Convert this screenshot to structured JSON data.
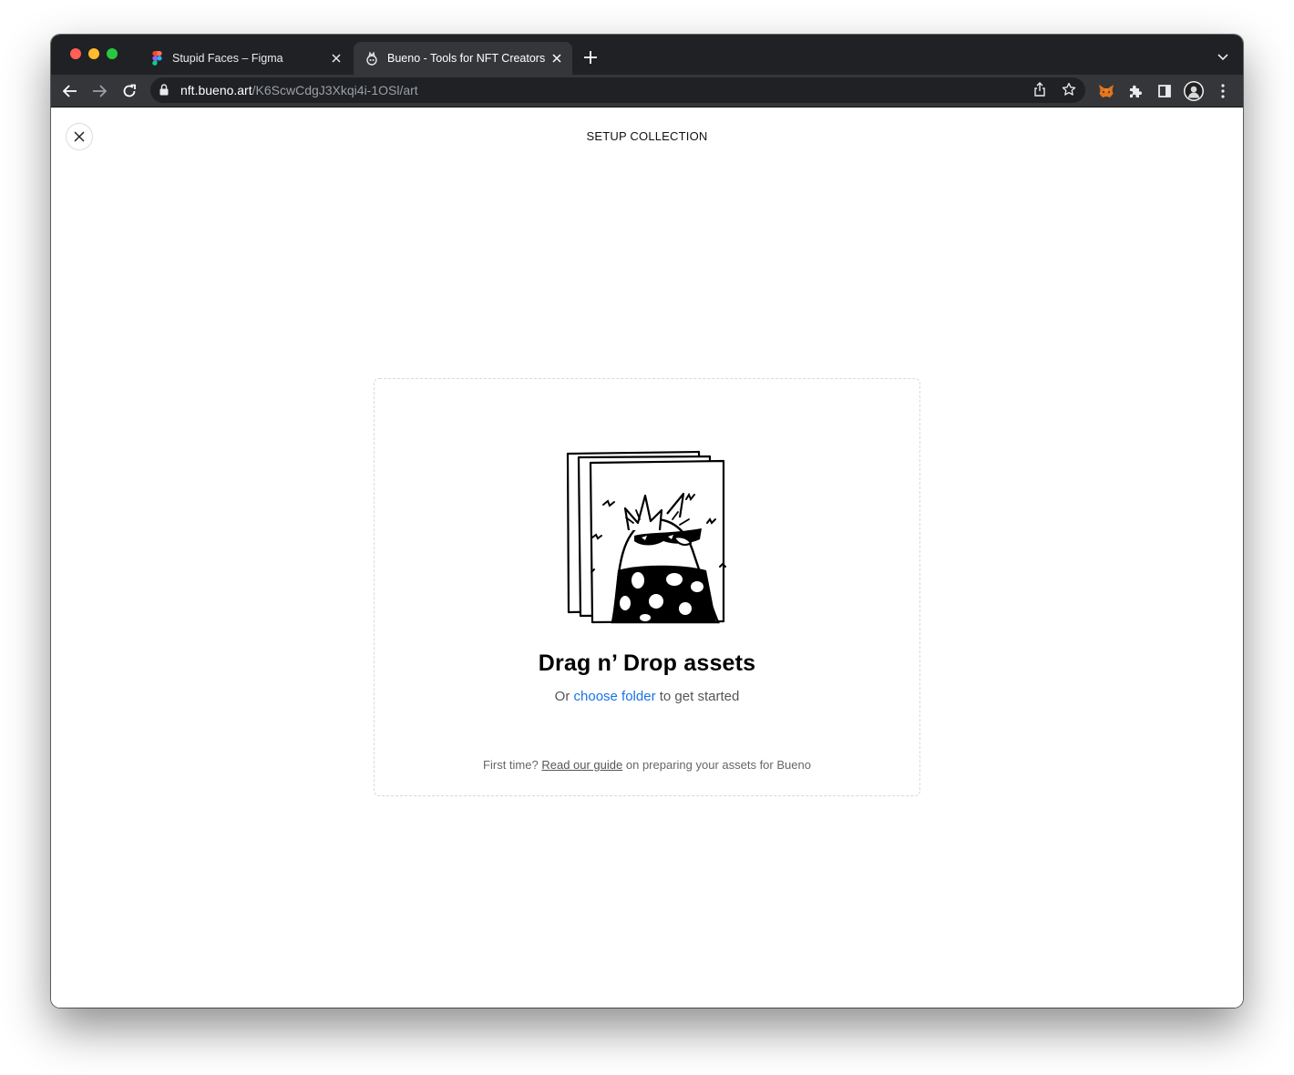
{
  "browser": {
    "tabs": [
      {
        "title": "Stupid Faces – Figma",
        "icon": "figma-icon",
        "active": false
      },
      {
        "title": "Bueno - Tools for NFT Creators",
        "icon": "bueno-icon",
        "active": true
      }
    ],
    "url_host": "nft.bueno.art",
    "url_path": "/K6ScwCdgJ3Xkqi4i-1OSl/art"
  },
  "page": {
    "title": "SETUP COLLECTION"
  },
  "dropzone": {
    "heading": "Drag n’ Drop assets",
    "sub_prefix": "Or",
    "sub_link": "choose folder",
    "sub_suffix": "to get started",
    "foot_prefix": "First time?",
    "foot_link": "Read our guide",
    "foot_suffix": "on preparing your assets for Bueno"
  },
  "colors": {
    "link": "#1a73e8",
    "chrome_dark": "#202124",
    "chrome_toolbar": "#35363a"
  }
}
